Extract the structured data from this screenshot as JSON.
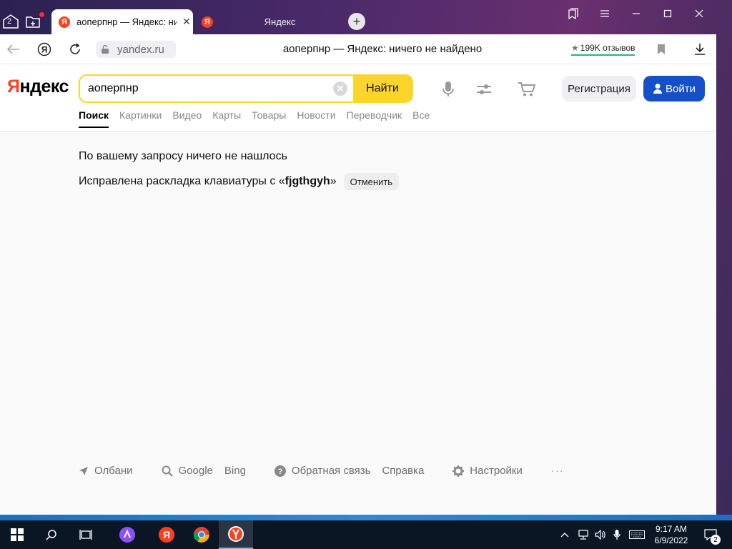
{
  "browser": {
    "tab_count_badge": "2",
    "tabs": [
      {
        "label": "аоперпнр — Яндекс: ни",
        "favicon": "Я"
      },
      {
        "label": "Яндекс",
        "favicon": "Я"
      }
    ],
    "url": "yandex.ru",
    "page_title": "аоперпнр — Яндекс: ничего не найдено",
    "reviews": "199K отзывов",
    "reviews_icon": "star-icon"
  },
  "header": {
    "logo_first": "Я",
    "logo_rest": "ндекс",
    "search_value": "аоперпнр",
    "search_button": "Найти",
    "register_button": "Регистрация",
    "login_button": "Войти"
  },
  "nav": {
    "items": [
      "Поиск",
      "Картинки",
      "Видео",
      "Карты",
      "Товары",
      "Новости",
      "Переводчик",
      "Все"
    ],
    "active_index": 0
  },
  "results": {
    "no_results": "По вашему запросу ничего не нашлось",
    "layout_fixed_prefix": "Исправлена раскладка клавиатуры с «",
    "layout_fixed_query": "fjgthgyh",
    "layout_fixed_suffix": "»",
    "cancel_button": "Отменить"
  },
  "footer": {
    "location": "Олбани",
    "google": "Google",
    "bing": "Bing",
    "feedback": "Обратная связь",
    "help": "Справка",
    "settings": "Настройки",
    "more": "···"
  },
  "taskbar": {
    "time": "9:17 AM",
    "date": "6/9/2022",
    "notifications": "2"
  },
  "colors": {
    "yandex_red": "#fc3f1d",
    "search_yellow": "#fcd52c",
    "login_blue": "#1451c8",
    "reviews_green": "#2fb36b"
  }
}
